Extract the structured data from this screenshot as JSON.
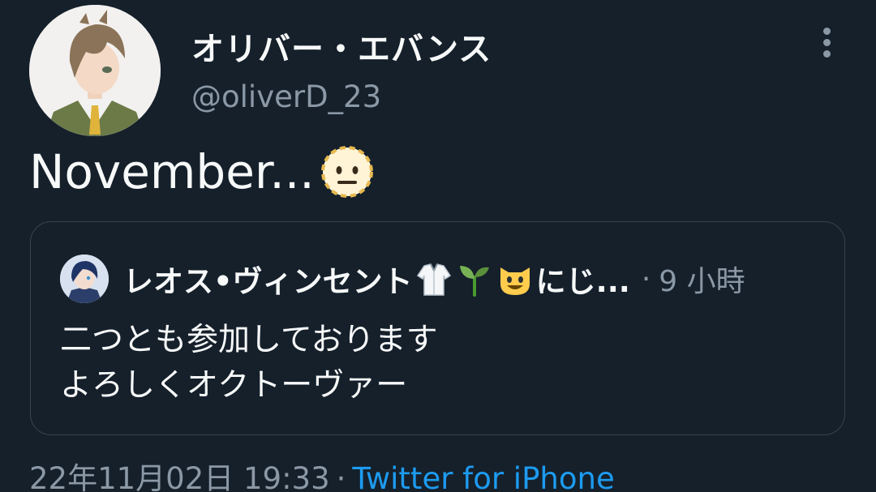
{
  "author": {
    "display_name": "オリバー・エバンス",
    "handle": "@oliverD_23",
    "avatar_icon": "anime-boy-avatar-icon"
  },
  "tweet": {
    "text": "November...",
    "emoji": "dotted-line-face-emoji"
  },
  "quoted_tweet": {
    "avatar_icon": "anime-avatar-icon",
    "name": "レオス•ヴィンセント",
    "name_emojis": [
      "lab-coat-emoji",
      "seedling-emoji",
      "smiling-cat-emoji"
    ],
    "name_continuation": "にじ...",
    "separator": "·",
    "time": "9 小時",
    "lines": [
      "二つとも参加しております",
      "よろしくオクトーヴァー"
    ]
  },
  "footer": {
    "timestamp": "22年11月02日 19:33",
    "separator": "·",
    "source": "Twitter for iPhone"
  },
  "colors": {
    "background": "#15202b",
    "primary_text": "#f7f9f9",
    "secondary_text": "#8b98a5",
    "link": "#1d9bf0",
    "border": "#38444d"
  }
}
